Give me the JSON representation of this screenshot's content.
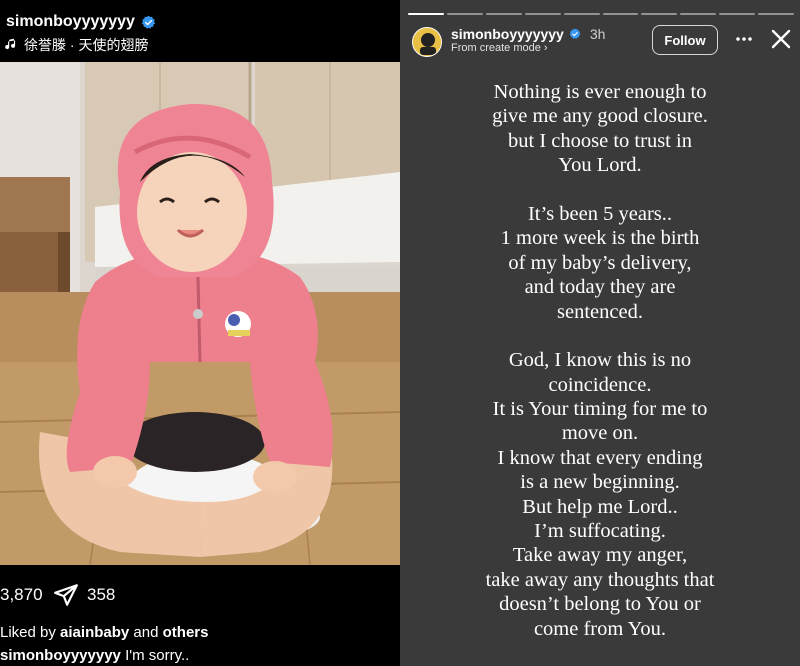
{
  "post": {
    "username": "simonboyyyyyyy",
    "song": "徐誉滕 · 天使的翅膀",
    "likes_count": "3,870",
    "shares_count": "358",
    "liked_by_prefix": "Liked by ",
    "liked_by_user": "aiainbaby",
    "liked_by_and": " and ",
    "liked_by_others": "others",
    "caption_user": "simonboyyyyyyy",
    "caption_text": " I'm sorry.."
  },
  "story": {
    "username": "simonboyyyyyyy",
    "time": "3h",
    "mode": "From create mode ›",
    "follow_label": "Follow",
    "progress_segments": 10,
    "progress_active": 1,
    "lines": [
      "Nothing is ever enough to",
      "give me any good closure.",
      "but I choose to trust in",
      "You Lord.",
      "",
      "It’s been 5 years..",
      "1 more week is the birth",
      "of my baby’s delivery,",
      "and today they are",
      "sentenced.",
      "",
      "God, I know this is no",
      "coincidence.",
      "It is Your timing for me to",
      "move on.",
      "I know that every ending",
      "is a new beginning.",
      "But help me Lord..",
      "I’m suffocating.",
      "Take away my anger,",
      "take away any thoughts that",
      "doesn’t belong to You or",
      "come from You."
    ]
  },
  "icons": {
    "verified": "verified-badge-icon",
    "music": "music-note-icon",
    "share": "send-icon",
    "more": "more-horizontal-icon",
    "close": "close-icon"
  },
  "colors": {
    "verified_blue": "#3897f0",
    "story_bg": "#3a3a3a",
    "jacket_pink": "#ee7f8d"
  }
}
